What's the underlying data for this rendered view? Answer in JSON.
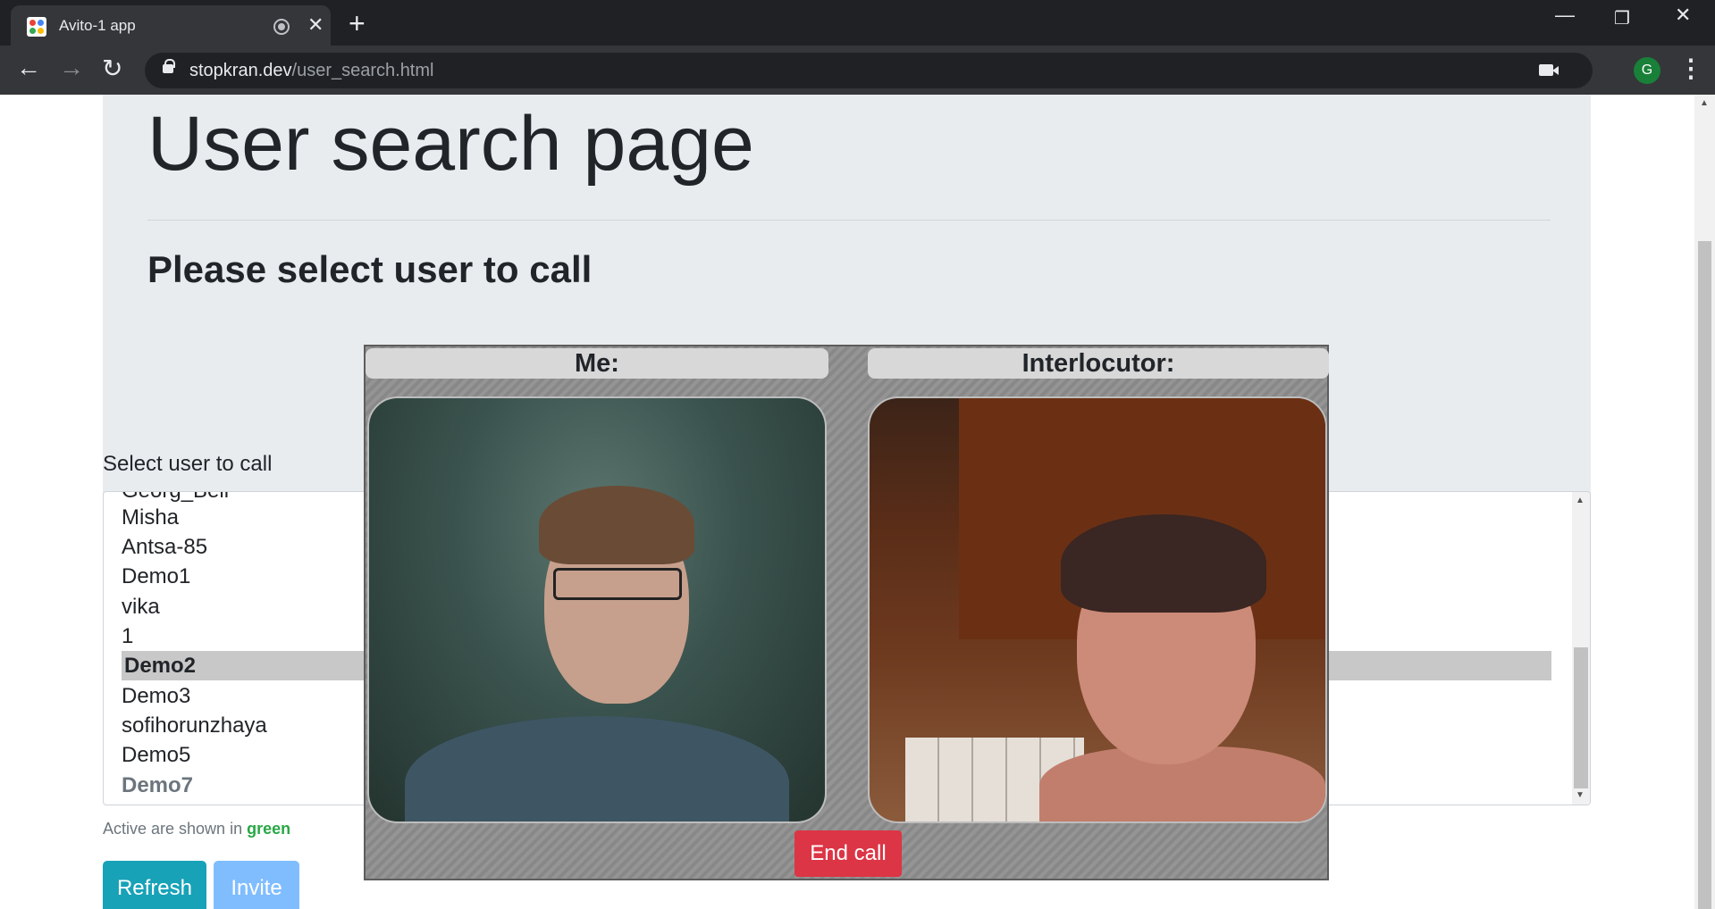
{
  "browser": {
    "tab_title": "Avito-1 app",
    "url_domain": "stopkran.dev",
    "url_path": "/user_search.html",
    "profile_initial": "G",
    "icons": [
      "back-icon",
      "forward-icon",
      "reload-icon",
      "lock-icon",
      "camera-icon",
      "star-icon",
      "menu-icon"
    ]
  },
  "page": {
    "title": "User search page",
    "subtitle": "Please select user to call",
    "select_label": "Select user to call",
    "users": [
      {
        "name": "Georg_Bell",
        "state": "partially-hidden"
      },
      {
        "name": "Misha",
        "state": "normal"
      },
      {
        "name": "Antsa-85",
        "state": "normal"
      },
      {
        "name": "Demo1",
        "state": "normal"
      },
      {
        "name": "vika",
        "state": "normal"
      },
      {
        "name": "1",
        "state": "normal"
      },
      {
        "name": "Demo2",
        "state": "selected"
      },
      {
        "name": "Demo3",
        "state": "normal"
      },
      {
        "name": "sofihorunzhaya",
        "state": "normal"
      },
      {
        "name": "Demo5",
        "state": "normal"
      },
      {
        "name": "Demo7",
        "state": "bold"
      }
    ],
    "hint_prefix": "Active are shown in",
    "hint_word": "green",
    "refresh_label": "Refresh",
    "invite_label": "Invite"
  },
  "call": {
    "me_label": "Me:",
    "interlocutor_label": "Interlocutor:",
    "end_call_label": "End call"
  },
  "colors": {
    "active_green": "#28a745",
    "end_call": "#dc3545",
    "refresh": "#17a2b8",
    "invite": "#80bdff"
  }
}
